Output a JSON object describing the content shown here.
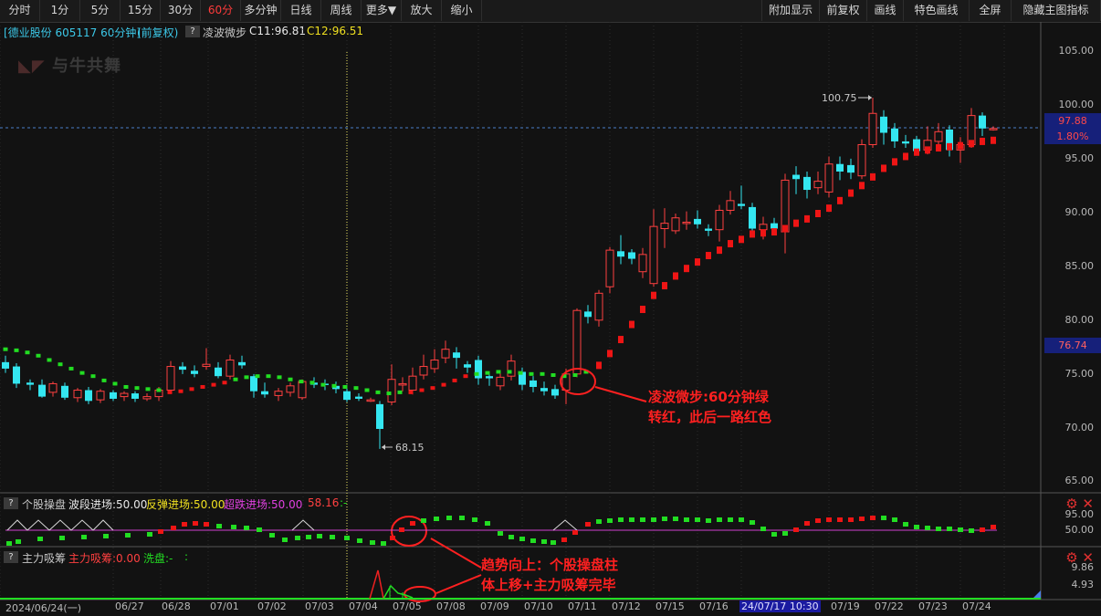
{
  "toolbar": {
    "left_items": [
      "分时",
      "1分",
      "5分",
      "15分",
      "30分",
      "60分",
      "多分钟",
      "日线",
      "周线",
      "更多▼",
      "放大",
      "缩小"
    ],
    "active": "60分",
    "right_items": [
      "附加显示",
      "前复权",
      "画线",
      "特色画线",
      "全屏",
      "隐藏主图指标"
    ]
  },
  "info": {
    "stock": "[德业股份 605117 60分钟]",
    "adjust": "(前复权)",
    "indicator": "凌波微步",
    "c1": "C11:96.81",
    "c2": "C12:96.51"
  },
  "watermark": "与牛共舞",
  "price_axis": [
    "105.00",
    "100.00",
    "95.00",
    "90.00",
    "85.00",
    "80.00",
    "75.00",
    "70.00",
    "65.00"
  ],
  "current_price": "97.88",
  "change_pct": "1.80%",
  "cursor_price": "76.74",
  "high_label": "100.75",
  "low_label": "68.15",
  "sub1": {
    "name": "个股操盘",
    "v1": "波段进场:50.00",
    "v2": "反弹进场:50.00",
    "v3": "超跌进场:50.00",
    "v4": "58.16",
    "v5": ":-",
    "axis": [
      "95.00",
      "50.00"
    ]
  },
  "sub2": {
    "name": "主力吸筹",
    "v1": "主力吸筹:0.00",
    "v2": "洗盘:-",
    "v3": ":",
    "axis": [
      "9.86",
      "4.93"
    ]
  },
  "dates": [
    "2024/06/24(一)",
    "06/27",
    "06/28",
    "07/01",
    "07/02",
    "07/03",
    "07/04",
    "07/05",
    "07/08",
    "07/09",
    "07/10",
    "07/11",
    "07/12",
    "07/15",
    "07/16",
    "24/07/17 10:30",
    "07/19",
    "07/22",
    "07/23",
    "07/24"
  ],
  "annotations": {
    "a1_line1": "凌波微步:60分钟绿",
    "a1_line2": "转红，此后一路红色",
    "a2_line1": "趋势向上：个股操盘柱",
    "a2_line2": "体上移+主力吸筹完毕"
  },
  "colors": {
    "up": "#ff4040",
    "down": "#34e6f0",
    "green": "#22dd22",
    "red": "#ee1515",
    "accent": "#ff3b3b"
  }
}
